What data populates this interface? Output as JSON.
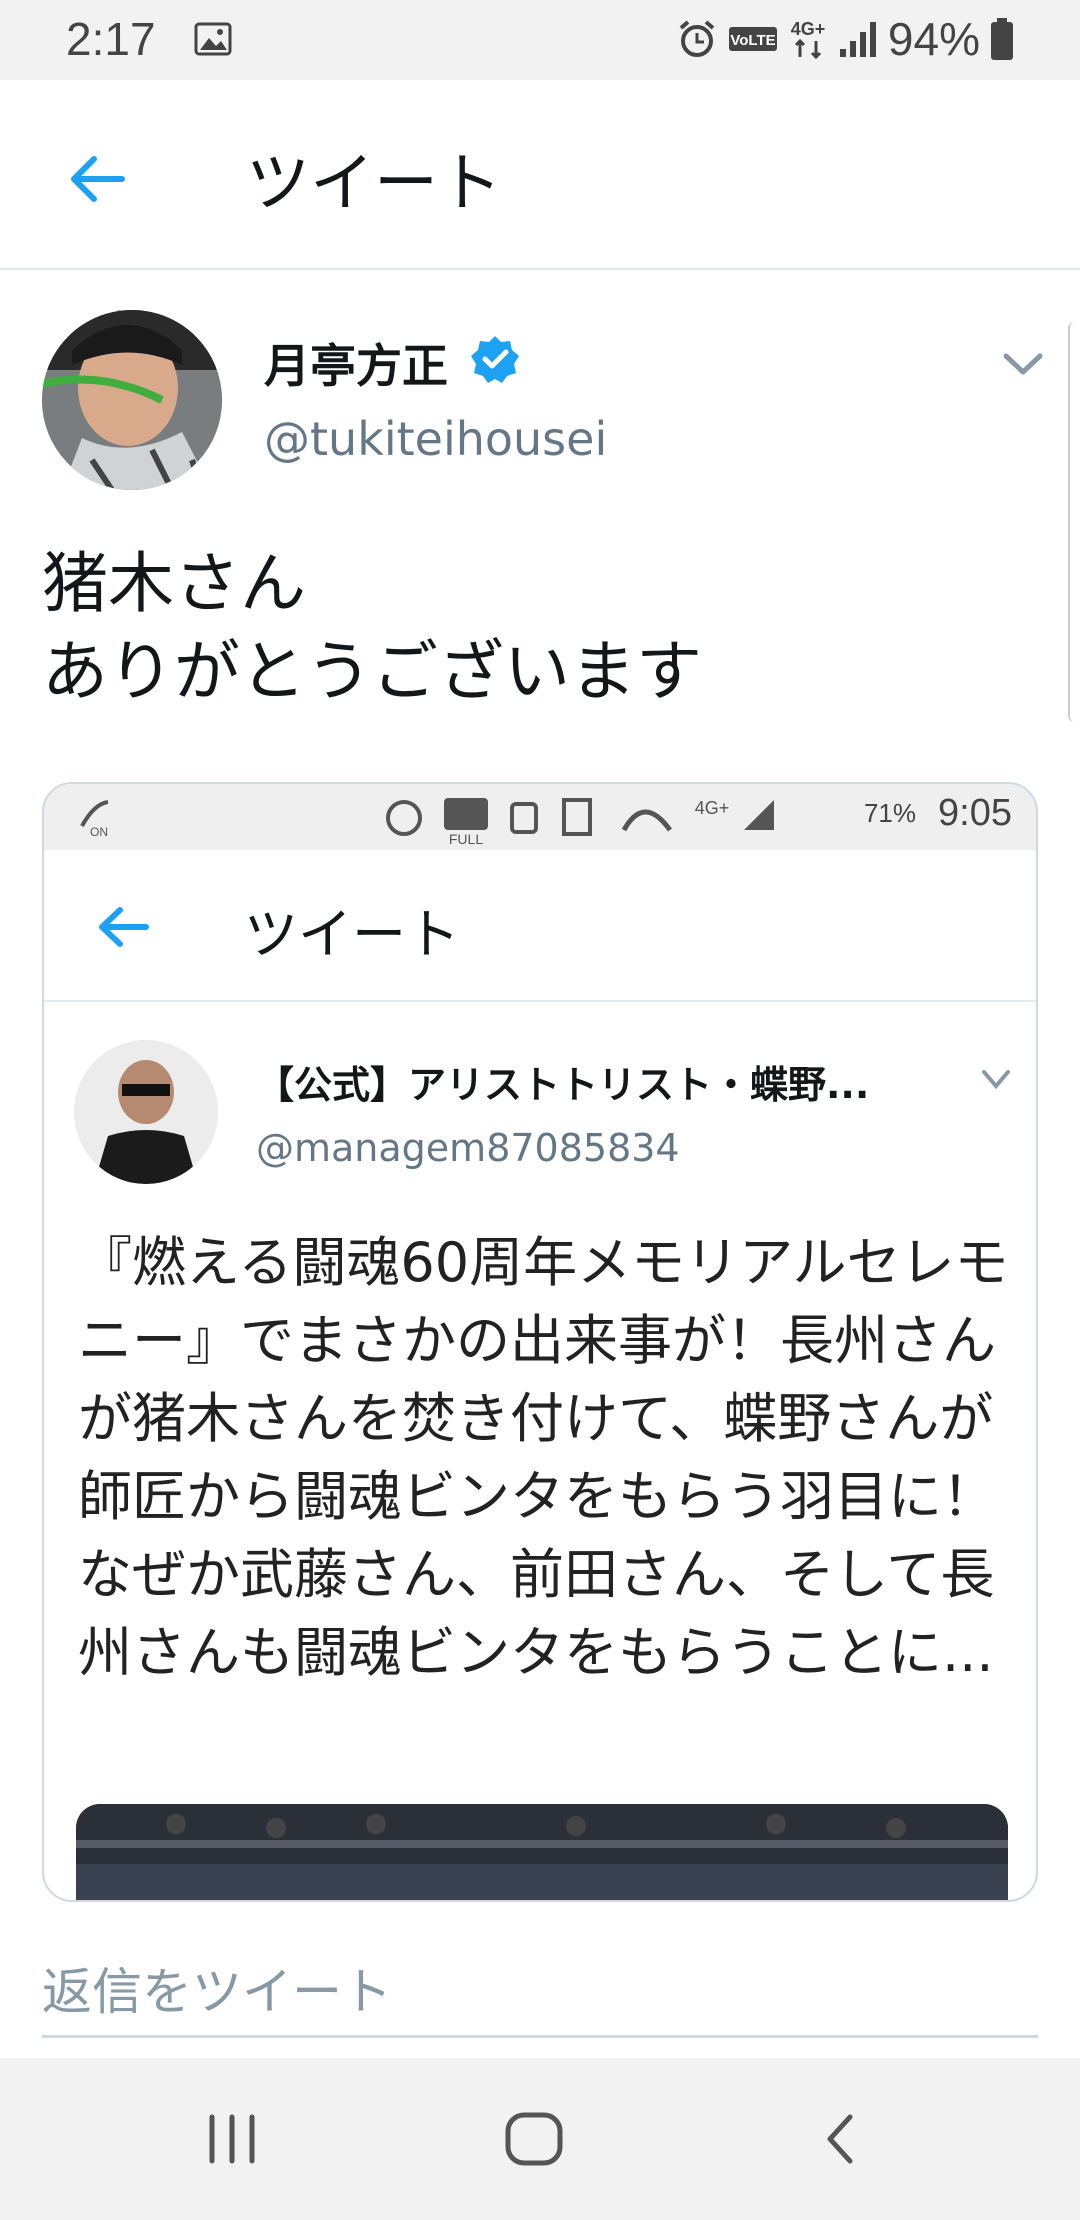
{
  "status_bar": {
    "time": "2:17",
    "battery": "94%",
    "icons": [
      "image-icon",
      "alarm-icon",
      "volte-icon",
      "4g-plus-icon",
      "signal-icon",
      "battery-icon"
    ]
  },
  "header": {
    "title": "ツイート",
    "back_icon": "arrow-left-icon"
  },
  "tweet": {
    "author_name": "月亭方正",
    "author_handle": "@tukiteihousei",
    "verified": true,
    "text_line1": "猪木さん",
    "text_line2": "ありがとうございます"
  },
  "media": {
    "status_battery": "71%",
    "status_time": "9:05",
    "header_title": "ツイート",
    "author_name": "【公式】アリストトリスト・蝶野...",
    "author_handle": "@managem87085834",
    "text": "『燃える闘魂60周年メモリアルセレモニー』でまさかの出来事が！長州さんが猪木さんを焚き付けて、蝶野さんが師匠から闘魂ビンタをもらう羽目に！なぜか武藤さん、前田さん、そして長州さんも闘魂ビンタをもらうことに..."
  },
  "reply": {
    "placeholder": "返信をツイート"
  },
  "colors": {
    "accent": "#1da1f2",
    "secondary_text": "#657786",
    "divider": "#e1e8ed"
  }
}
